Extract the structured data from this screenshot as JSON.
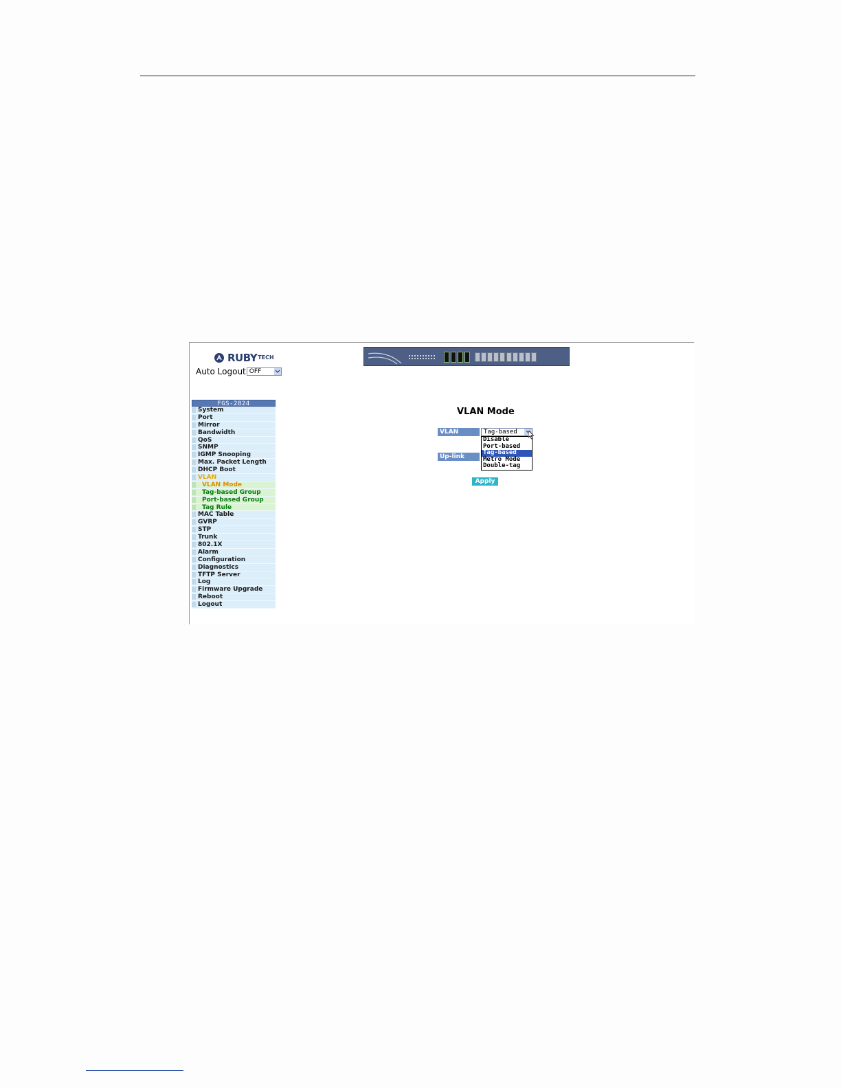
{
  "logo": {
    "brand": "RUBY",
    "brand_suffix": "TECH"
  },
  "auto_logout": {
    "label": "Auto Logout",
    "value": "OFF"
  },
  "menu": {
    "title": "FGS-2824",
    "items": [
      {
        "label": "System"
      },
      {
        "label": "Port"
      },
      {
        "label": "Mirror"
      },
      {
        "label": "Bandwidth"
      },
      {
        "label": "QoS"
      },
      {
        "label": "SNMP"
      },
      {
        "label": "IGMP Snooping"
      },
      {
        "label": "Max. Packet Length"
      },
      {
        "label": "DHCP Boot"
      },
      {
        "label": "VLAN"
      },
      {
        "label": "VLAN Mode"
      },
      {
        "label": "Tag-based Group"
      },
      {
        "label": "Port-based Group"
      },
      {
        "label": "Tag Rule"
      },
      {
        "label": "MAC Table"
      },
      {
        "label": "GVRP"
      },
      {
        "label": "STP"
      },
      {
        "label": "Trunk"
      },
      {
        "label": "802.1X"
      },
      {
        "label": "Alarm"
      },
      {
        "label": "Configuration"
      },
      {
        "label": "Diagnostics"
      },
      {
        "label": "TFTP Server"
      },
      {
        "label": "Log"
      },
      {
        "label": "Firmware Upgrade"
      },
      {
        "label": "Reboot"
      },
      {
        "label": "Logout"
      }
    ]
  },
  "content": {
    "title": "VLAN Mode",
    "vlan_mode_label": "VLAN Mode",
    "vlan_mode_value": "Tag-based",
    "uplink_label": "Up-link Port",
    "options": [
      "Disable",
      "Port-based",
      "Tag-based",
      "Metro Mode",
      "Double-tag"
    ],
    "apply_label": "Apply"
  },
  "colors": {
    "menu_header": "#5778b4",
    "menu_item_bg": "#dbeefa",
    "submenu_bg": "#d9f3d3",
    "active_menu": "#e8a800",
    "apply_button": "#2bb5c6",
    "selected_option": "#2e55b8"
  }
}
